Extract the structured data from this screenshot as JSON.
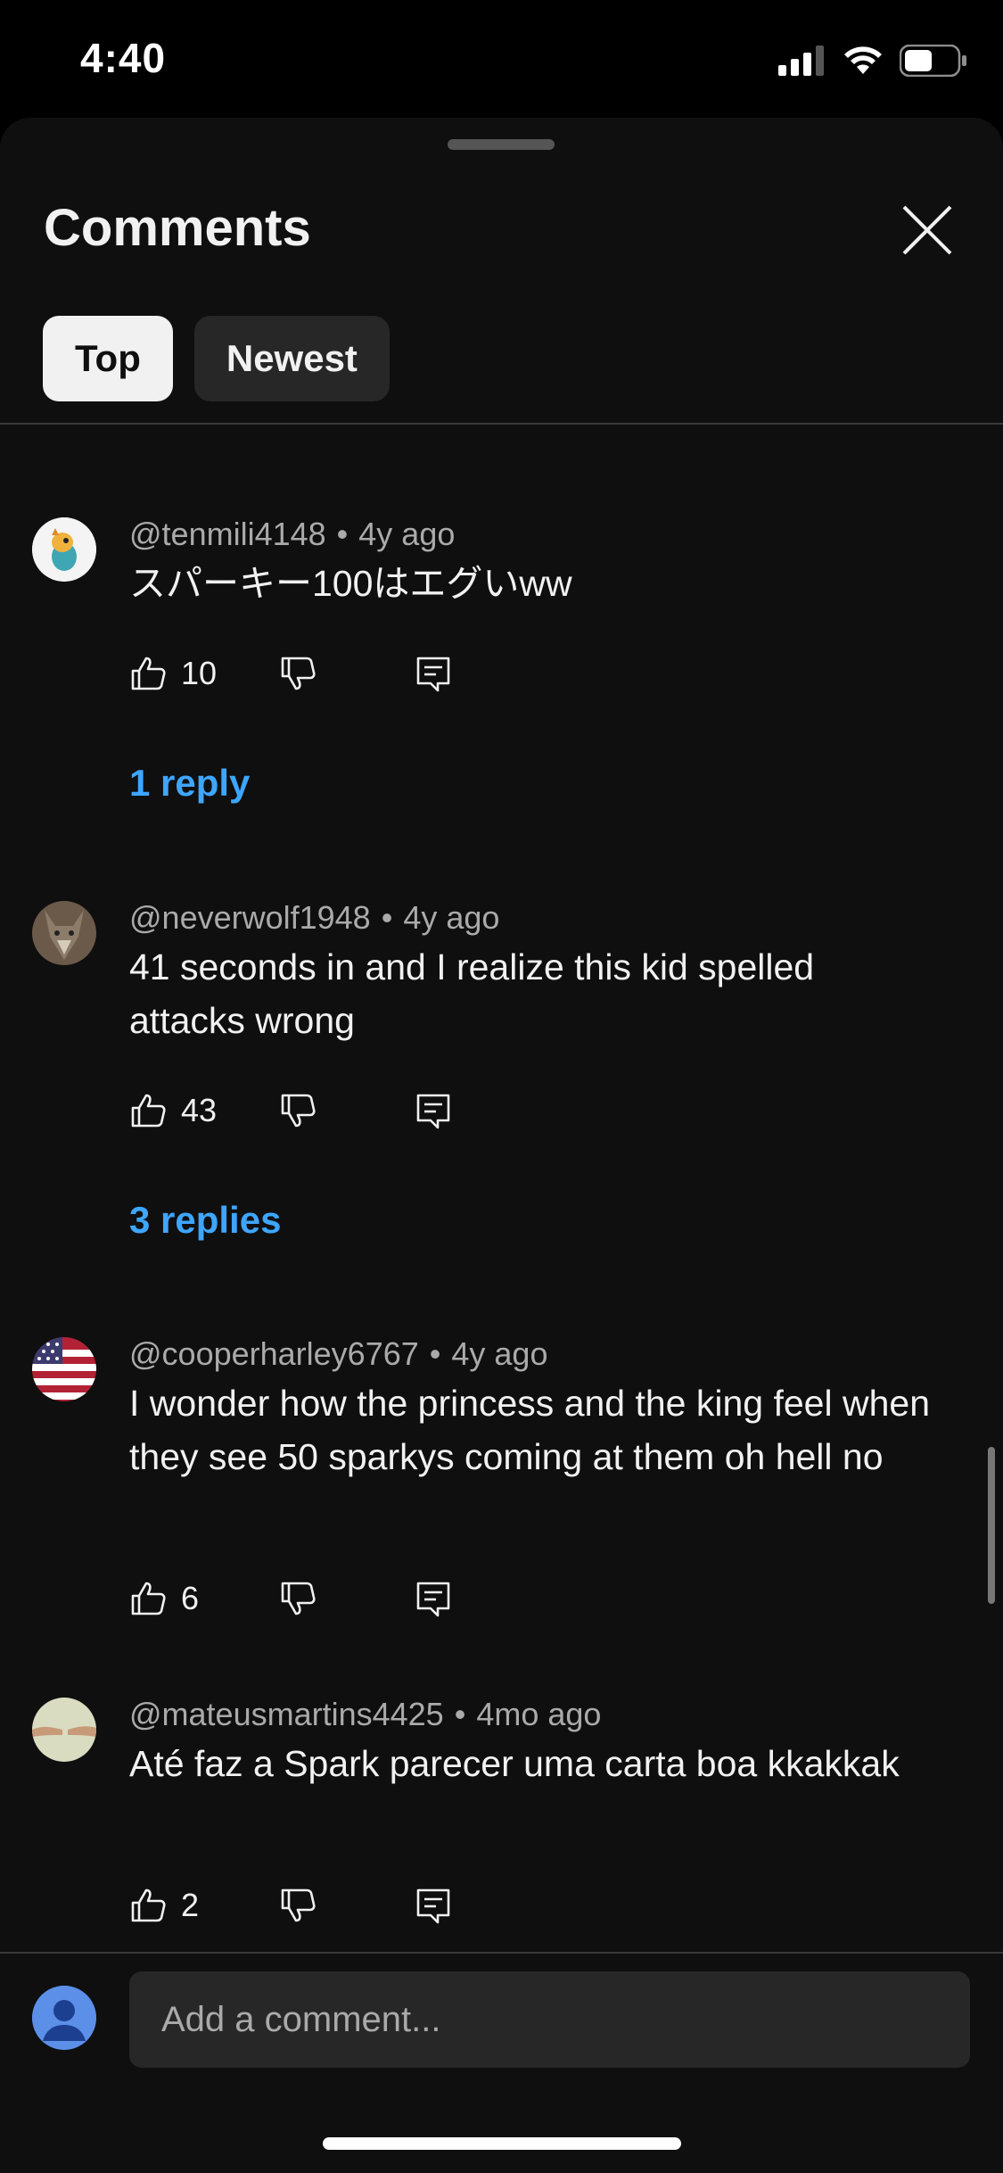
{
  "status_bar": {
    "time": "4:40"
  },
  "sheet": {
    "title": "Comments",
    "chips": [
      {
        "label": "Top",
        "active": true
      },
      {
        "label": "Newest",
        "active": false
      }
    ]
  },
  "comments": [
    {
      "handle": "@tenmili4148",
      "age": "4y ago",
      "text": "スパーキー100はエグいww",
      "likes": "10",
      "replies": "1 reply"
    },
    {
      "handle": "@neverwolf1948",
      "age": "4y ago",
      "text": "41 seconds in and I realize this kid spelled attacks wrong",
      "likes": "43",
      "replies": "3 replies"
    },
    {
      "handle": "@cooperharley6767",
      "age": "4y ago",
      "text": "I wonder how the princess and the king feel when they see 50 sparkys coming at them oh hell no",
      "likes": "6"
    },
    {
      "handle": "@mateusmartins4425",
      "age": "4mo ago",
      "text": "Até faz a Spark parecer uma carta boa kkakkak",
      "likes": "2"
    }
  ],
  "composer": {
    "placeholder": "Add a comment..."
  },
  "colors": {
    "link": "#3ea6ff",
    "sheet_bg": "#0f0f0f",
    "chip_active": "#f1f1f1",
    "chip_inactive": "#272727"
  }
}
